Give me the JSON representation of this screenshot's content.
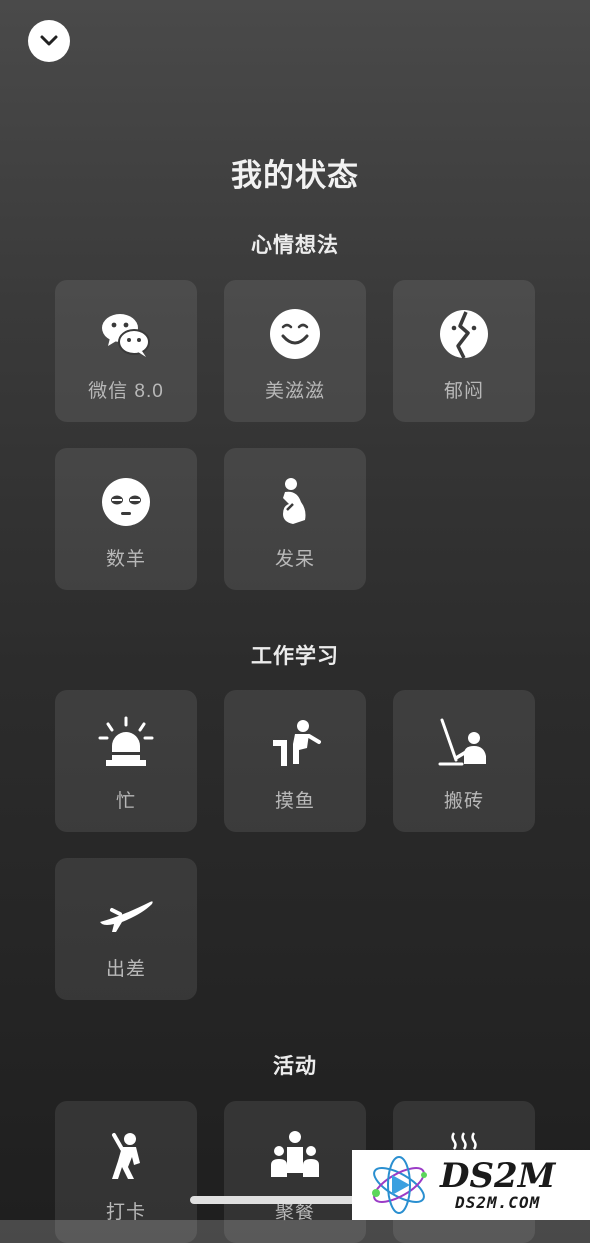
{
  "header": {
    "title": "我的状态"
  },
  "sections": [
    {
      "title": "心情想法",
      "items": [
        {
          "label": "微信 8.0",
          "icon": "wechat-icon"
        },
        {
          "label": "美滋滋",
          "icon": "smiley-icon"
        },
        {
          "label": "郁闷",
          "icon": "broken-heart-icon"
        },
        {
          "label": "数羊",
          "icon": "sleepy-face-icon"
        },
        {
          "label": "发呆",
          "icon": "daydream-person-icon"
        }
      ]
    },
    {
      "title": "工作学习",
      "items": [
        {
          "label": "忙",
          "icon": "busy-siren-icon"
        },
        {
          "label": "摸鱼",
          "icon": "slacking-person-icon"
        },
        {
          "label": "搬砖",
          "icon": "laptop-worker-icon"
        },
        {
          "label": "出差",
          "icon": "airplane-icon"
        }
      ]
    },
    {
      "title": "活动",
      "items": [
        {
          "label": "打卡",
          "icon": "check-in-person-icon"
        },
        {
          "label": "聚餐",
          "icon": "group-people-icon"
        },
        {
          "label": "",
          "icon": "hot-drink-icon"
        }
      ]
    }
  ],
  "watermark": {
    "main": "DS2M",
    "sub": "DS2M.COM"
  }
}
